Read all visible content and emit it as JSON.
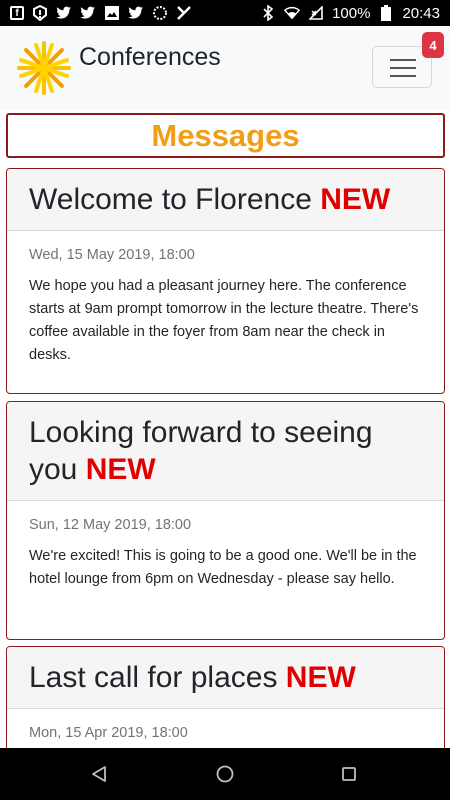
{
  "status_bar": {
    "battery": "100%",
    "time": "20:43",
    "left_icons": [
      "facebook-icon",
      "alert-icon",
      "twitter-icon",
      "twitter-icon",
      "image-icon",
      "twitter-icon",
      "sync-icon",
      "vpn-icon"
    ],
    "right_icons": [
      "bluetooth-icon",
      "wifi-icon",
      "signal-icon",
      "battery-icon"
    ]
  },
  "header": {
    "brand": "Conferences",
    "menu_badge": "4"
  },
  "page": {
    "title": "Messages"
  },
  "messages": [
    {
      "title": "Welcome to Florence",
      "tag": "NEW",
      "date": "Wed, 15 May 2019, 18:00",
      "body": "We hope you had a pleasant journey here. The conference starts at 9am prompt tomorrow in the lecture theatre. There's coffee available in the foyer from 8am near the check in desks."
    },
    {
      "title": "Looking forward to seeing you",
      "tag": "NEW",
      "date": "Sun, 12 May 2019, 18:00",
      "body": "We're excited! This is going to be a good one. We'll be in the hotel lounge from 6pm on Wednesday - please say hello."
    },
    {
      "title": "Last call for places",
      "tag": "NEW",
      "date": "Mon, 15 Apr 2019, 18:00",
      "body": ""
    }
  ],
  "colors": {
    "accent_orange": "#f29d16",
    "new_red": "#e00000",
    "card_border": "#8b1a1a",
    "badge_red": "#dc3545"
  }
}
